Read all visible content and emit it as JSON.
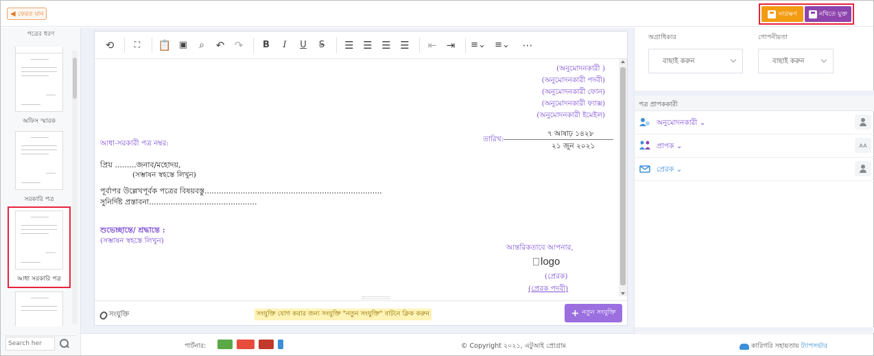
{
  "topbar": {
    "back_label": "ফেরত যান",
    "save_label": "সংরক্ষণ",
    "note_label": "নথিতে যুক্ত"
  },
  "left": {
    "title": "পত্রের ধরণ",
    "items": [
      {
        "label": ""
      },
      {
        "label": "অফিস স্মারক"
      },
      {
        "label": "সরকারি পত্র"
      },
      {
        "label": "আধা সরকারি পত্র"
      },
      {
        "label": ""
      }
    ],
    "search_placeholder": "Search her"
  },
  "toolbar": {
    "icons": [
      "history-icon",
      "fullscreen-icon",
      "paste-icon",
      "select-all-icon",
      "find-icon",
      "undo-icon",
      "redo-icon",
      "bold-icon",
      "italic-icon",
      "underline-icon",
      "strikethrough-icon",
      "align-left-icon",
      "align-center-icon",
      "align-right-icon",
      "justify-icon",
      "outdent-icon",
      "indent-icon",
      "numbered-list-icon",
      "bullet-list-icon",
      "more-icon"
    ]
  },
  "doc": {
    "approver_block": [
      "(অনুমোদনকারী )",
      "(অনুমোদনকারী পদবী)",
      "(অনুমোদনকারী ফোন)",
      "(অনুমোদনকারী ফ্যাক্স)",
      "(অনুমোদনকারী ইমেইল)"
    ],
    "memo_label": "আধা-সরকারী পত্র নম্বর:",
    "date_label": "তারিখ:",
    "date_bn": "৭ আষাঢ় ১৪২৮",
    "date_en": "২১ জুন ২০২১",
    "salutation": "প্রিয়  .........জনাব/মহোদয়,",
    "salutation_note": "(সম্ভাষন স্বহস্তে লিখুন)",
    "subject_line": "পূর্বাপর উল্লেখপূর্বক পত্রের বিষয়বস্তু..........................................................................",
    "proposal_line": "সুনির্দিষ্ট প্রস্তাবনা.............................................",
    "closing": "শুভেচ্ছান্তে/ শ্রদ্ধান্তে :",
    "closing_note": "(সম্ভাষন স্বহস্তে লিখুন)",
    "sincerely": "আন্তরিকতাবে আপনার,",
    "logo_alt": "logo",
    "sender": "(প্রেরক)",
    "sender_designation": "(প্রেরক পদবী)"
  },
  "attach": {
    "label": "সংযুক্তি",
    "hint": "সংযুক্তি যোগ করার জন্য সংযুক্তি \"নতুন সংযুক্তি\" বাটনে ক্লিক করুন",
    "new_button": "নতুন সংযুক্তি"
  },
  "right": {
    "priority_label": "অগ্রাধিকার",
    "priority_value": "বাছাই করুন",
    "secrecy_label": "গোপনীয়তা",
    "secrecy_value": "বাছাই করুন",
    "recipients_title": "পত্র প্রাপককারী",
    "recipients": [
      {
        "label": "অনুমোদনকারী ⌄",
        "color": "#7e4fd6"
      },
      {
        "label": "প্রাপক ⌄",
        "color": "#7e4fd6"
      },
      {
        "label": "প্রেরক ⌄",
        "color": "#3a8fd8"
      }
    ]
  },
  "footer": {
    "partner_label": "পার্টনার:",
    "copyright": "© Copyright ২০২১, এটুআই প্রোগ্রাম",
    "support_text": "কারিগরি সহায়তায়",
    "support_brand": "ট্যাপসর্ভার"
  },
  "colors": {
    "accent_purple": "#7e4fd6",
    "save_orange": "#f39c12",
    "note_purple": "#8e44ad",
    "highlight_red": "#e8203a"
  }
}
